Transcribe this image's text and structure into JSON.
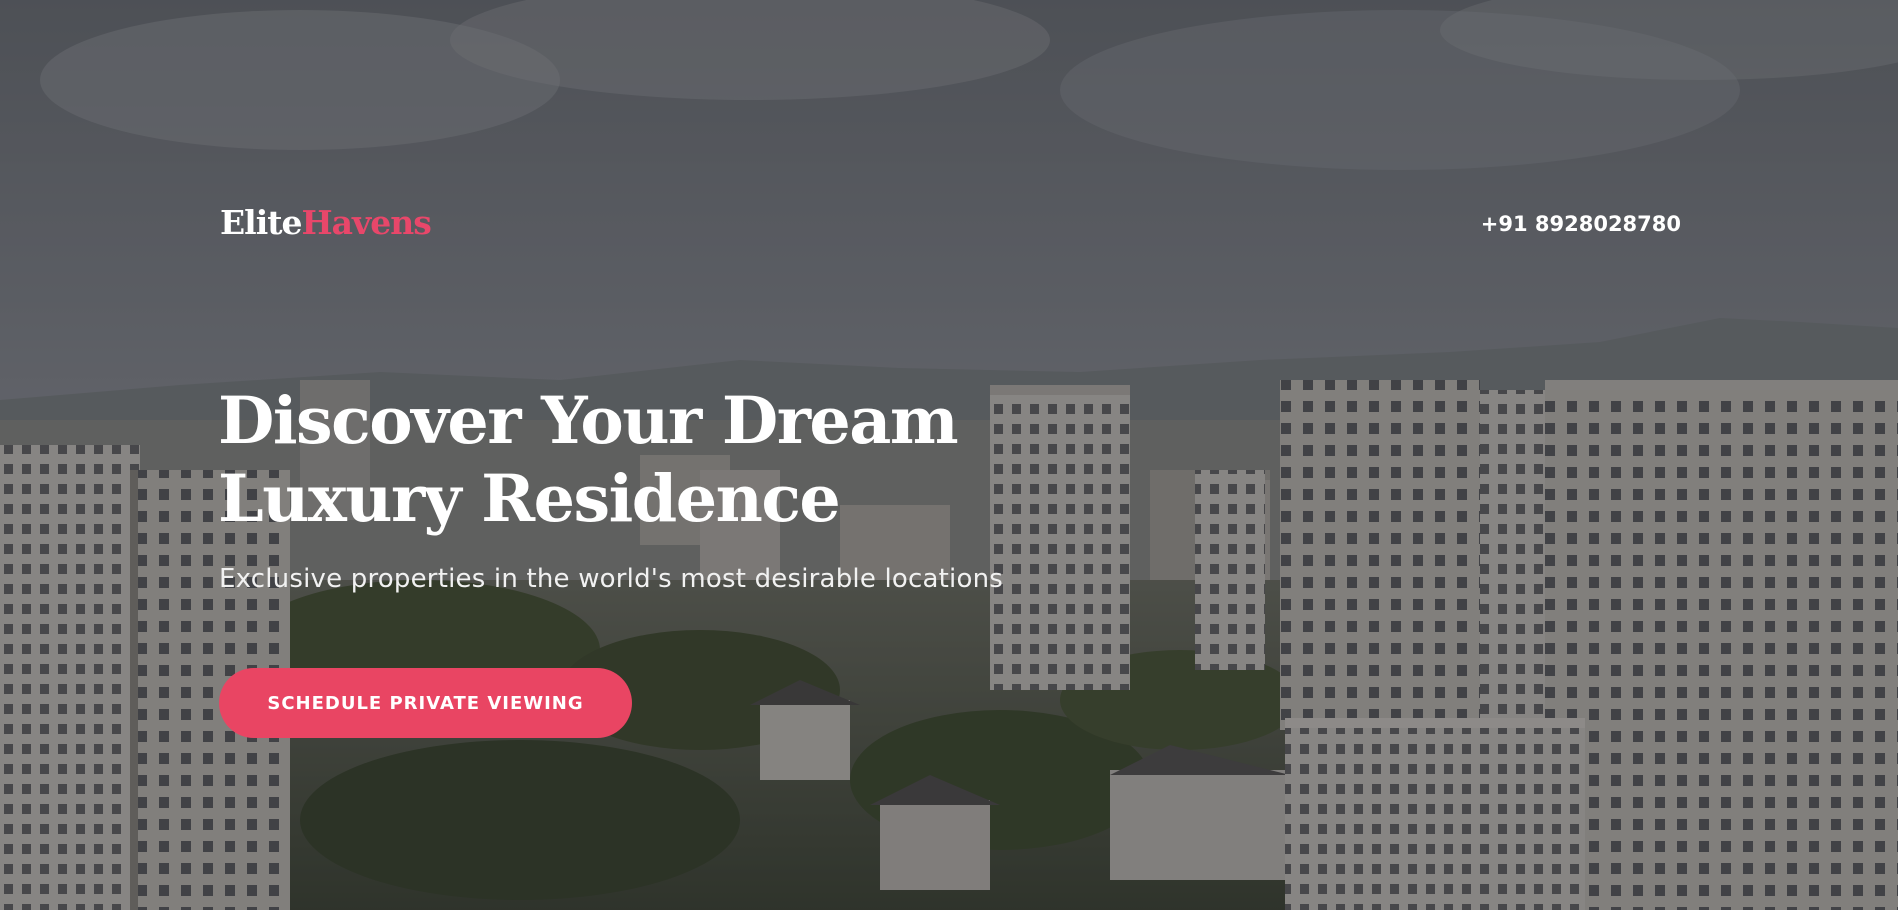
{
  "header": {
    "logo_primary": "Elite",
    "logo_accent": "Havens",
    "phone": "+91 8928028780"
  },
  "hero": {
    "headline_line1": "Discover Your Dream",
    "headline_line2": "Luxury Residence",
    "subtitle": "Exclusive properties in the world's most desirable locations",
    "cta_label": "SCHEDULE PRIVATE VIEWING"
  },
  "colors": {
    "accent": "#e94563",
    "text": "#ffffff",
    "overlay": "#1e2024"
  }
}
